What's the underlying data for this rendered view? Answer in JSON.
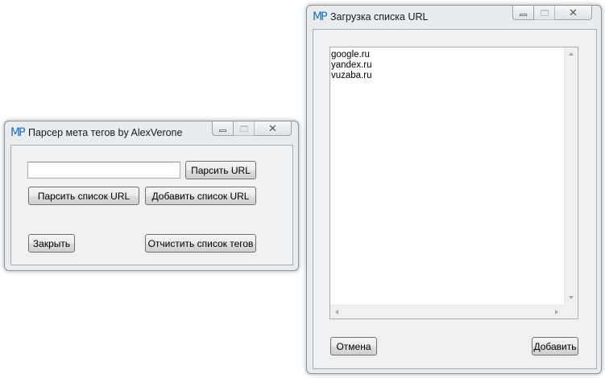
{
  "parser_window": {
    "title": "Парсер мета тегов by AlexVerone",
    "icon": "mp-logo-icon",
    "url_input": {
      "value": "",
      "placeholder": ""
    },
    "buttons": {
      "parse_url": "Парсить URL",
      "parse_list": "Парсить список URL",
      "add_list": "Добавить список URL",
      "close": "Закрыть",
      "clear_tags": "Отчистить список тегов"
    }
  },
  "url_loader_window": {
    "title": "Загрузка списка URL",
    "icon": "mp-logo-icon",
    "url_list": [
      "google.ru",
      "yandex.ru",
      "vuzaba.ru"
    ],
    "buttons": {
      "cancel": "Отмена",
      "add": "Добавить"
    }
  },
  "window_controls": {
    "close_glyph": "✕"
  },
  "colors": {
    "icon_blue": "#1e6fb8",
    "window_frame": "#e9ecef",
    "client_bg": "#f0f0f0"
  }
}
